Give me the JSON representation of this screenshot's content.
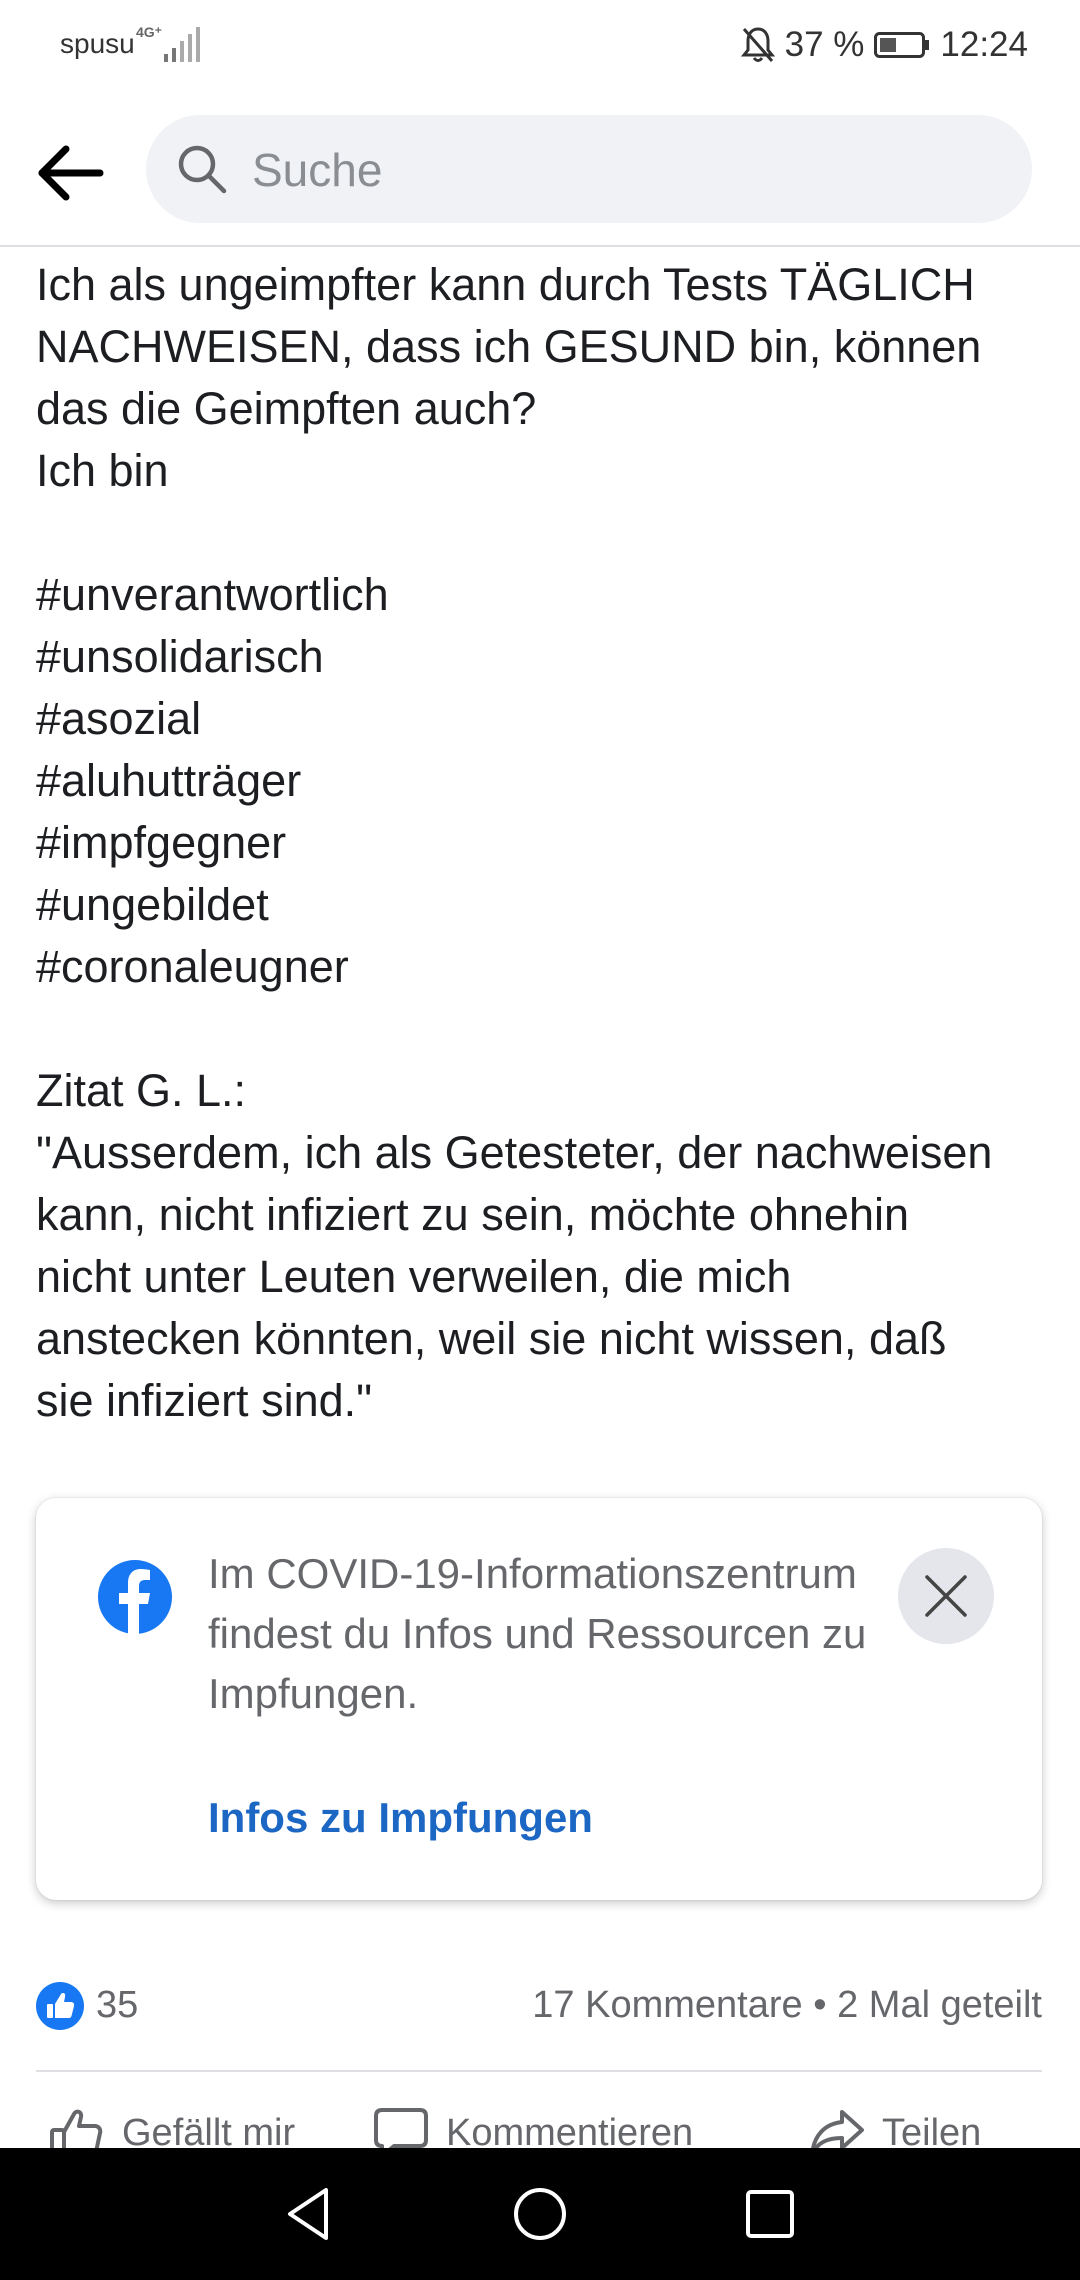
{
  "status_bar": {
    "carrier": "spusu",
    "network": "4G⁺",
    "battery": "37 %",
    "time": "12:24",
    "icons": [
      "signal-icon",
      "mute-icon",
      "battery-icon"
    ]
  },
  "header": {
    "search_placeholder": "Suche",
    "icons": [
      "back-arrow-icon",
      "search-icon"
    ]
  },
  "post": {
    "lines": [
      "Ich als ungeimpfter kann durch Tests TÄGLICH",
      "NACHWEISEN, dass ich GESUND bin, können",
      "das die Geimpften auch?",
      "Ich bin",
      "",
      "#unverantwortlich",
      "#unsolidarisch",
      "#asozial",
      "#aluhutträger",
      "#impfgegner",
      "#ungebildet",
      "#coronaleugner",
      "",
      "Zitat G. L.:",
      "\"Ausserdem, ich als Getesteter, der nachweisen",
      "kann, nicht infiziert zu sein, möchte ohnehin",
      "nicht unter Leuten verweilen, die mich",
      "anstecken könnten, weil sie nicht wissen, daß",
      "sie infiziert sind.\""
    ]
  },
  "info_card": {
    "text": "Im COVID-19-Informationszentrum findest du Infos und Ressourcen zu Impfungen.",
    "link": "Infos zu Impfungen",
    "icons": [
      "facebook-logo-icon",
      "close-icon"
    ]
  },
  "reactions": {
    "like_count": "35",
    "comments": "17 Kommentare",
    "separator": "•",
    "shares": "2 Mal geteilt"
  },
  "actions": {
    "like": "Gefällt mir",
    "comment": "Kommentieren",
    "share": "Teilen"
  },
  "colors": {
    "accent_blue": "#1b67c3",
    "facebook_blue": "#1877f2",
    "secondary_text": "#65676b",
    "search_bg": "#f0f2f5"
  }
}
